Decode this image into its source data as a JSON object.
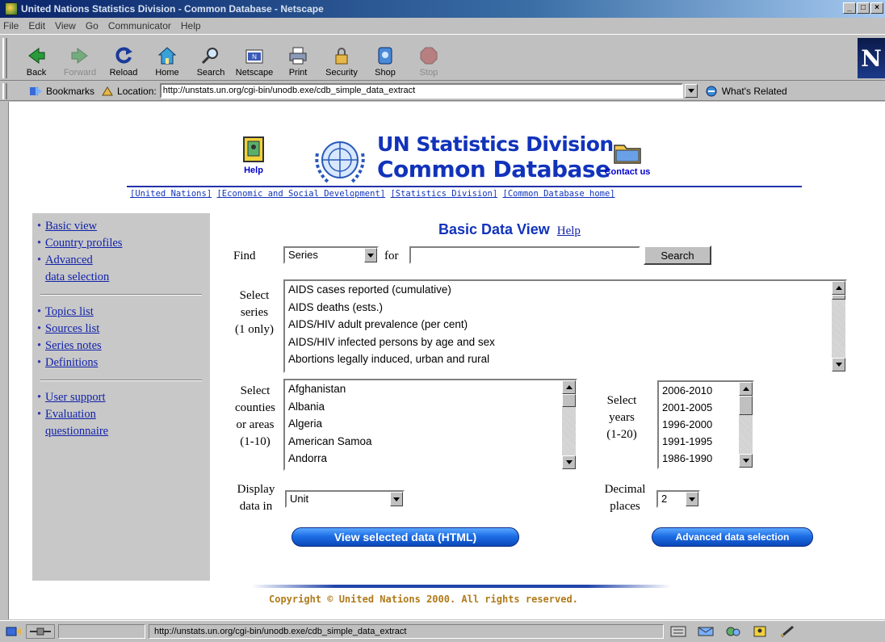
{
  "window": {
    "title": "United Nations Statistics Division - Common Database - Netscape",
    "controls": [
      "_",
      "□",
      "×"
    ]
  },
  "menu": [
    "File",
    "Edit",
    "View",
    "Go",
    "Communicator",
    "Help"
  ],
  "toolbar": {
    "buttons": [
      {
        "label": "Back",
        "icon": "back-arrow-icon",
        "enabled": true
      },
      {
        "label": "Forward",
        "icon": "forward-arrow-icon",
        "enabled": false
      },
      {
        "label": "Reload",
        "icon": "reload-icon",
        "enabled": true
      },
      {
        "label": "Home",
        "icon": "home-icon",
        "enabled": true
      },
      {
        "label": "Search",
        "icon": "search-icon",
        "enabled": true
      },
      {
        "label": "Netscape",
        "icon": "netscape-icon",
        "enabled": true
      },
      {
        "label": "Print",
        "icon": "print-icon",
        "enabled": true
      },
      {
        "label": "Security",
        "icon": "lock-icon",
        "enabled": true
      },
      {
        "label": "Shop",
        "icon": "shop-icon",
        "enabled": true
      },
      {
        "label": "Stop",
        "icon": "stop-icon",
        "enabled": false
      }
    ],
    "logo": "N"
  },
  "location": {
    "bookmarks_label": "Bookmarks",
    "location_label": "Location:",
    "url": "http://unstats.un.org/cgi-bin/unodb.exe/cdb_simple_data_extract",
    "related_label": "What's Related"
  },
  "header": {
    "help_label": "Help",
    "brand_line1": "UN Statistics Division",
    "brand_line2": "Common Database",
    "contact_label": "Contact us",
    "nav_links": [
      "[United Nations]",
      "[Economic and Social Development]",
      "[Statistics Division]",
      "[Common Database home]"
    ]
  },
  "sidebar": {
    "group1": [
      {
        "lines": [
          "Basic view"
        ]
      },
      {
        "lines": [
          "Country profiles"
        ]
      },
      {
        "lines": [
          "Advanced",
          "data selection"
        ]
      }
    ],
    "group2": [
      {
        "lines": [
          "Topics list"
        ]
      },
      {
        "lines": [
          "Sources list"
        ]
      },
      {
        "lines": [
          "Series notes"
        ]
      },
      {
        "lines": [
          "Definitions"
        ]
      }
    ],
    "group3": [
      {
        "lines": [
          "User support"
        ]
      },
      {
        "lines": [
          "Evaluation",
          "questionnaire"
        ]
      }
    ]
  },
  "main": {
    "title": "Basic Data View",
    "help_link": "Help",
    "find_label": "Find",
    "find_select": "Series",
    "for_label": "for",
    "search_value": "",
    "search_button": "Search",
    "series_label": [
      "Select",
      "series",
      "(1 only)"
    ],
    "series_options": [
      "AIDS cases reported (cumulative)",
      "AIDS deaths (ests.)",
      "AIDS/HIV adult prevalence (per cent)",
      "AIDS/HIV infected persons by age and sex",
      "Abortions legally induced, urban and rural"
    ],
    "countries_label": [
      "Select",
      "counties",
      "or areas",
      "(1-10)"
    ],
    "country_options": [
      "Afghanistan",
      "Albania",
      "Algeria",
      "American Samoa",
      "Andorra"
    ],
    "years_label": [
      "Select",
      "years",
      "(1-20)"
    ],
    "year_options": [
      "2006-2010",
      "2001-2005",
      "1996-2000",
      "1991-1995",
      "1986-1990"
    ],
    "display_label": [
      "Display",
      "data in"
    ],
    "display_select": "Unit",
    "decimal_label": [
      "Decimal",
      "places"
    ],
    "decimal_select": "2",
    "view_button": "View selected data (HTML)",
    "advanced_button": "Advanced data selection"
  },
  "footer": {
    "copyright": "Copyright © United Nations 2000. All rights reserved."
  },
  "status": {
    "text": "http://unstats.un.org/cgi-bin/unodb.exe/cdb_simple_data_extract"
  }
}
